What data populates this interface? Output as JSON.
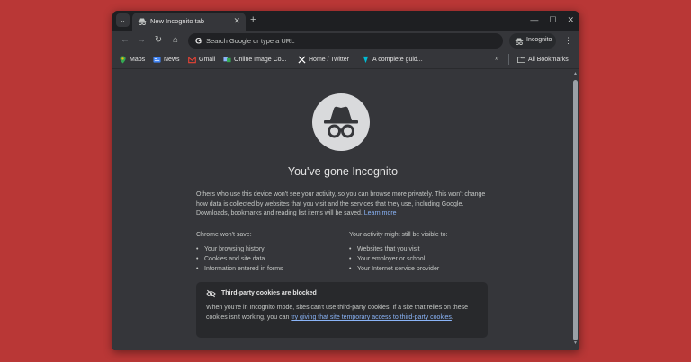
{
  "colors": {
    "background": "#b93736",
    "window": "#202124",
    "surface": "#35363a",
    "card": "#28292c",
    "link": "#8ab4f8",
    "text_primary": "#e3e3e3",
    "text_secondary": "#c4c7c5"
  },
  "tab": {
    "title": "New Incognito tab",
    "close_glyph": "✕",
    "icon": "incognito-icon"
  },
  "titlebar": {
    "tab_menu_glyph": "⌄",
    "new_tab_glyph": "+",
    "minimize_glyph": "—",
    "maximize_glyph": "☐",
    "close_glyph": "✕"
  },
  "toolbar": {
    "back_glyph": "←",
    "forward_glyph": "→",
    "reload_glyph": "↻",
    "home_glyph": "⌂",
    "omnibox_placeholder": "Search Google or type a URL",
    "incognito_label": "Incognito",
    "menu_glyph": "⋮"
  },
  "bookmarks": {
    "items": [
      {
        "label": "Maps",
        "icon": "maps-icon",
        "color": "#34a853"
      },
      {
        "label": "News",
        "icon": "news-icon",
        "color": "#4285f4"
      },
      {
        "label": "Gmail",
        "icon": "gmail-icon",
        "color": "#ea4335"
      },
      {
        "label": "Online Image Co...",
        "icon": "image-converter-icon",
        "color": "#8ab4f8"
      },
      {
        "label": "Home / Twitter",
        "icon": "x-twitter-icon",
        "color": "#ffffff"
      },
      {
        "label": "A complete guid...",
        "icon": "guide-icon",
        "color": "#00bcd4"
      }
    ],
    "more_glyph": "»",
    "all_bookmarks_label": "All Bookmarks"
  },
  "page": {
    "heading": "You've gone Incognito",
    "intro_text": "Others who use this device won't see your activity, so you can browse more privately. This won't change how data is collected by websites that you visit and the services that they use, including Google. Downloads, bookmarks and reading list items will be saved.",
    "learn_more": "Learn more",
    "wont_save_title": "Chrome won't save:",
    "wont_save_items": [
      "Your browsing history",
      "Cookies and site data",
      "Information entered in forms"
    ],
    "visible_to_title": "Your activity might still be visible to:",
    "visible_to_items": [
      "Websites that you visit",
      "Your employer or school",
      "Your Internet service provider"
    ],
    "cookies": {
      "title": "Third-party cookies are blocked",
      "body": "When you're in Incognito mode, sites can't use third-party cookies. If a site that relies on these cookies isn't working, you can",
      "link": "try giving that site temporary access to third-party cookies",
      "end": "."
    }
  }
}
